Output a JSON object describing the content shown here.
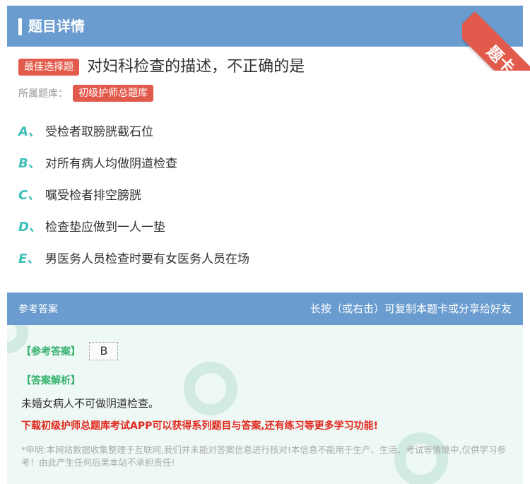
{
  "header": {
    "title": "题目详情",
    "corner_badge": "题卡"
  },
  "question": {
    "type_tag": "最佳选择题",
    "text": "对妇科检查的描述，不正确的是",
    "bank_label": "所属题库：",
    "bank_name": "初级护师总题库"
  },
  "options": [
    {
      "letter": "A、",
      "text": "受检者取膀胱截石位"
    },
    {
      "letter": "B、",
      "text": "对所有病人均做阴道检查"
    },
    {
      "letter": "C、",
      "text": "嘱受检者排空膀胱"
    },
    {
      "letter": "D、",
      "text": "检查垫应做到一人一垫"
    },
    {
      "letter": "E、",
      "text": "男医务人员检查时要有女医务人员在场"
    }
  ],
  "answer": {
    "section_title": "参考答案",
    "copy_hint": "长按（或右击）可复制本题卡或分享给好友",
    "answer_label": "【参考答案】",
    "answer_value": "B",
    "analysis_label": "【答案解析】",
    "analysis_text": "未婚女病人不可做阴道检查。",
    "promo": "下载初级护师总题库考试APP可以获得系列题目与答案,还有练习等更多学习功能!",
    "disclaimer": "*申明:本网站数据收集整理于互联网,我们并未能对答案信息进行核对!本信息不能用于生产、生活、考试等情境中,仅供学习参考！由此产生任何后果本站不承担责任!"
  },
  "colors": {
    "header_bg": "#6a9ccf",
    "tag_red": "#e25a4b",
    "option_letter": "#3ec0b8",
    "answer_green": "#37b26f",
    "promo_red": "#e0281e"
  }
}
